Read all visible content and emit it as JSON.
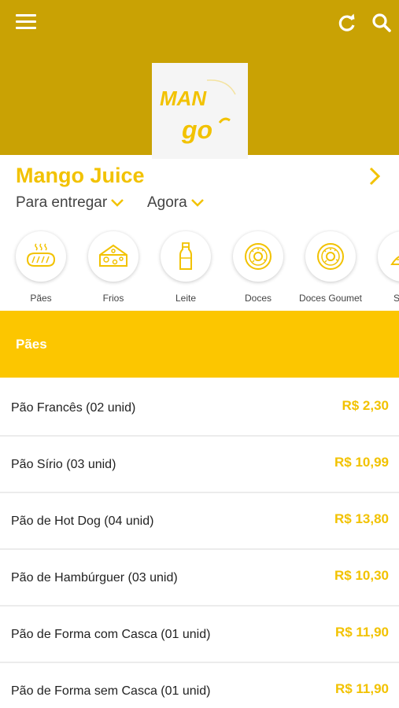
{
  "header": {
    "logo_text": "MAN go"
  },
  "store": {
    "name": "Mango Juice",
    "delivery_mode": "Para entregar",
    "delivery_time": "Agora"
  },
  "categories": [
    {
      "label": "Pães",
      "icon": "bread-icon"
    },
    {
      "label": "Frios",
      "icon": "cheese-icon"
    },
    {
      "label": "Leite",
      "icon": "milk-bottle-icon"
    },
    {
      "label": "Doces",
      "icon": "donut-icon"
    },
    {
      "label": "Doces Goumet",
      "icon": "donut-icon"
    },
    {
      "label": "Salg",
      "icon": "snack-icon"
    }
  ],
  "section": {
    "title": "Pães"
  },
  "products": [
    {
      "name": "Pão Francês (02 unid)",
      "price": "R$ 2,30"
    },
    {
      "name": "Pão Sírio (03 unid)",
      "price": "R$ 10,99"
    },
    {
      "name": "Pão de Hot Dog (04 unid)",
      "price": "R$ 13,80"
    },
    {
      "name": "Pão de Hambúrguer (03 unid)",
      "price": "R$ 10,30"
    },
    {
      "name": "Pão de Forma com Casca (01 unid)",
      "price": "R$ 11,90"
    },
    {
      "name": "Pão de Forma sem Casca (01 unid)",
      "price": "R$ 11,90"
    }
  ],
  "colors": {
    "header": "#c9a204",
    "accent": "#f2c200",
    "section": "#fcc600"
  }
}
